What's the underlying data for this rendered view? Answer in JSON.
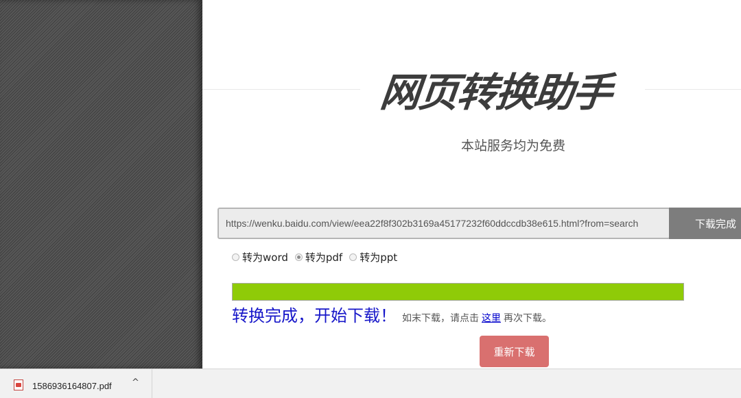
{
  "site": {
    "title": "网页转换助手",
    "subtitle": "本站服务均为免费"
  },
  "form": {
    "url_value": "https://wenku.baidu.com/view/eea22f8f302b3169a45177232f60ddccdb38e615.html?from=search",
    "download_button_label": "下载完成",
    "options": [
      {
        "label": "转为word",
        "checked": false
      },
      {
        "label": "转为pdf",
        "checked": true
      },
      {
        "label": "转为ppt",
        "checked": false
      }
    ]
  },
  "progress": {
    "percent": 100,
    "color": "#8fcb08"
  },
  "status": {
    "message": "转换完成，开始下载！",
    "hint_prefix": "如末下载，请点击",
    "link_text": "这里",
    "hint_suffix": "再次下载。"
  },
  "redownload_label": "重新下载",
  "download_bar": {
    "filename": "1586936164807.pdf",
    "file_icon": "pdf-file-icon",
    "chevron": "^"
  }
}
